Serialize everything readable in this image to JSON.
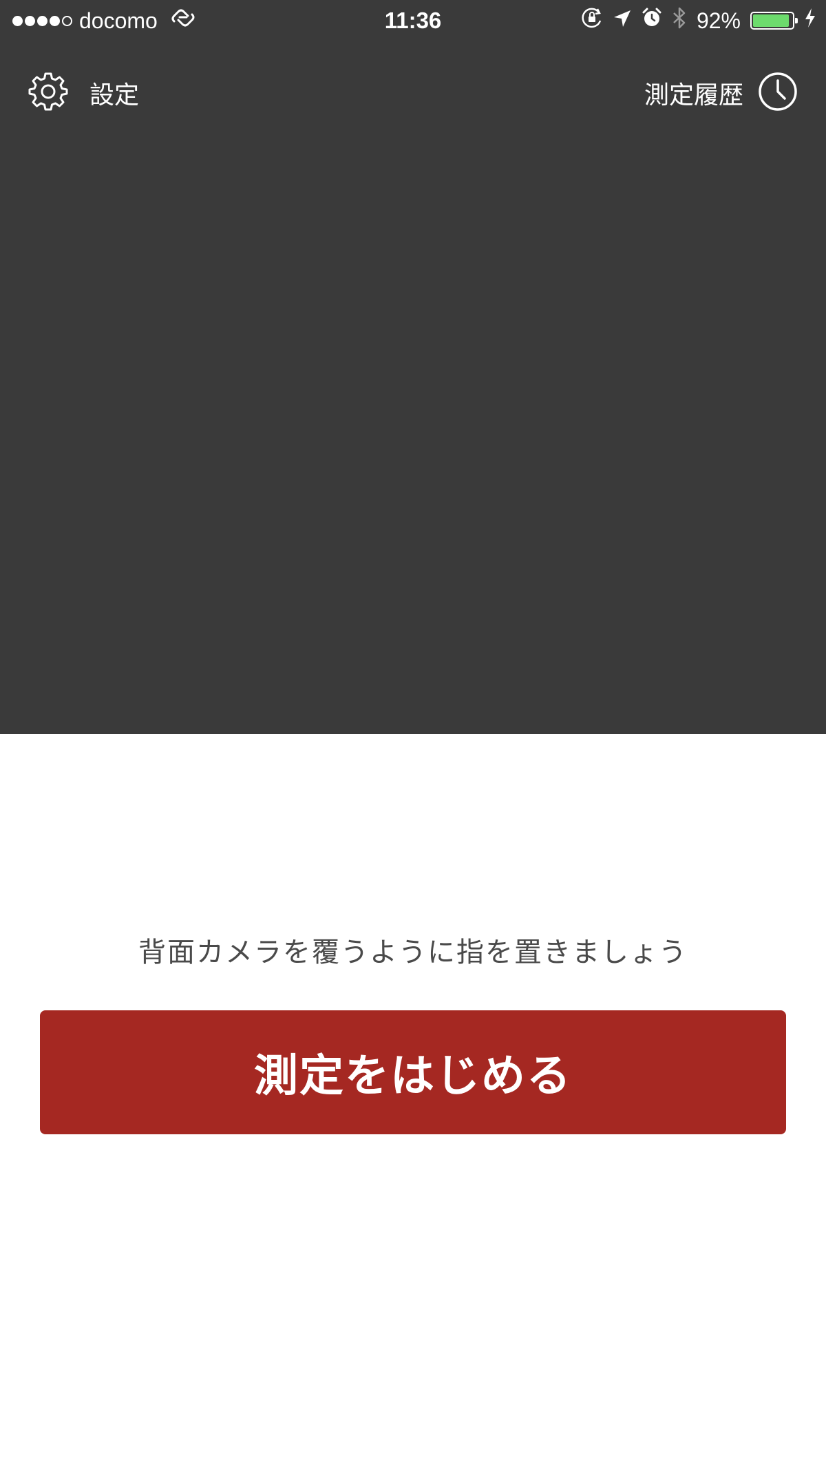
{
  "status_bar": {
    "signal_filled": 4,
    "signal_total": 5,
    "carrier": "docomo",
    "time": "11:36",
    "battery_percent_text": "92%",
    "battery_level": 0.92,
    "battery_color": "#6ddb6d"
  },
  "nav": {
    "settings_label": "設定",
    "history_label": "測定履歴"
  },
  "main": {
    "instruction": "背面カメラを覆うように指を置きましょう",
    "start_button_label": "測定をはじめる",
    "button_color": "#a52822"
  },
  "icons": {
    "settings": "gear-icon",
    "history": "clock-icon",
    "wifi_calling": "link-icon",
    "orientation_lock": "rotation-lock-icon",
    "location": "location-arrow-icon",
    "alarm": "alarm-icon",
    "bluetooth": "bluetooth-icon",
    "charging": "bolt-icon"
  }
}
